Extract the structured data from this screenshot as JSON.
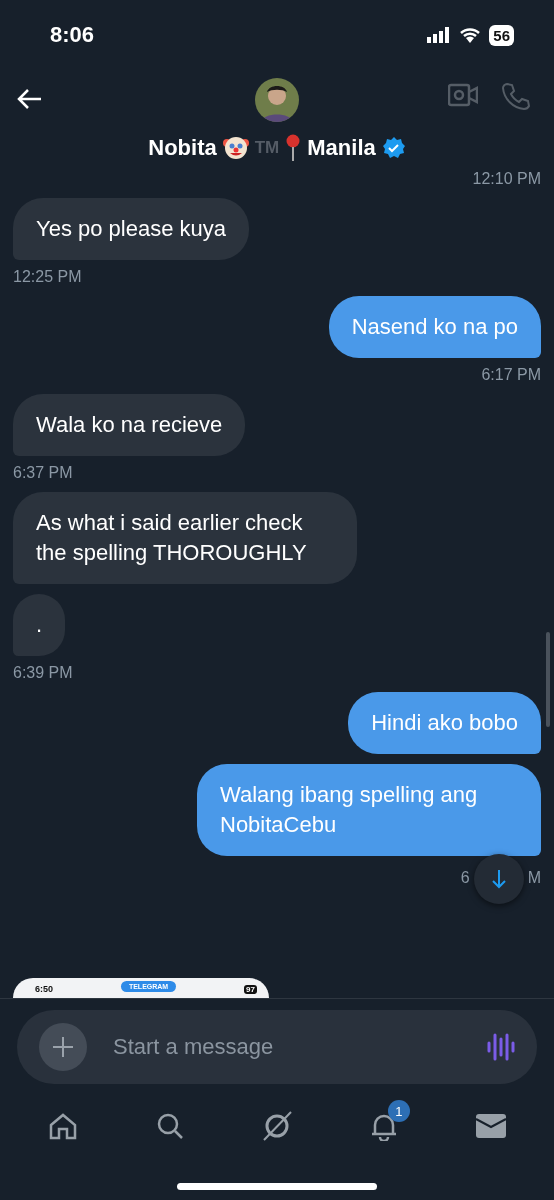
{
  "status_bar": {
    "time": "8:06",
    "battery": "56"
  },
  "header": {
    "name": "Nobita",
    "trademark": "TM",
    "location": "Manila",
    "verified": true
  },
  "messages": [
    {
      "sent": true,
      "time": "12:10 PM"
    },
    {
      "sent": false,
      "texts": [
        "Yes po please kuya"
      ],
      "time": "12:25 PM"
    },
    {
      "sent": true,
      "texts": [
        "Nasend ko na po"
      ],
      "time": "6:17 PM"
    },
    {
      "sent": false,
      "texts": [
        "Wala ko na recieve"
      ],
      "time": "6:37 PM"
    },
    {
      "sent": false,
      "texts": [
        "As what i said earlier check the spelling THOROUGHLY",
        "."
      ],
      "time": "6:39 PM"
    },
    {
      "sent": true,
      "texts": [
        "Hindi ako bobo",
        "Walang ibang spelling ang NobitaCebu"
      ],
      "time": "6",
      "time_end": "M"
    }
  ],
  "shared_screenshot": {
    "time": "6:50",
    "app_pill": "TELEGRAM",
    "battery": "97"
  },
  "composer": {
    "placeholder": "Start a message"
  },
  "nav": [
    {
      "kind": "home"
    },
    {
      "kind": "search"
    },
    {
      "kind": "grok"
    },
    {
      "kind": "bell",
      "badge": "1"
    },
    {
      "kind": "mail"
    }
  ]
}
